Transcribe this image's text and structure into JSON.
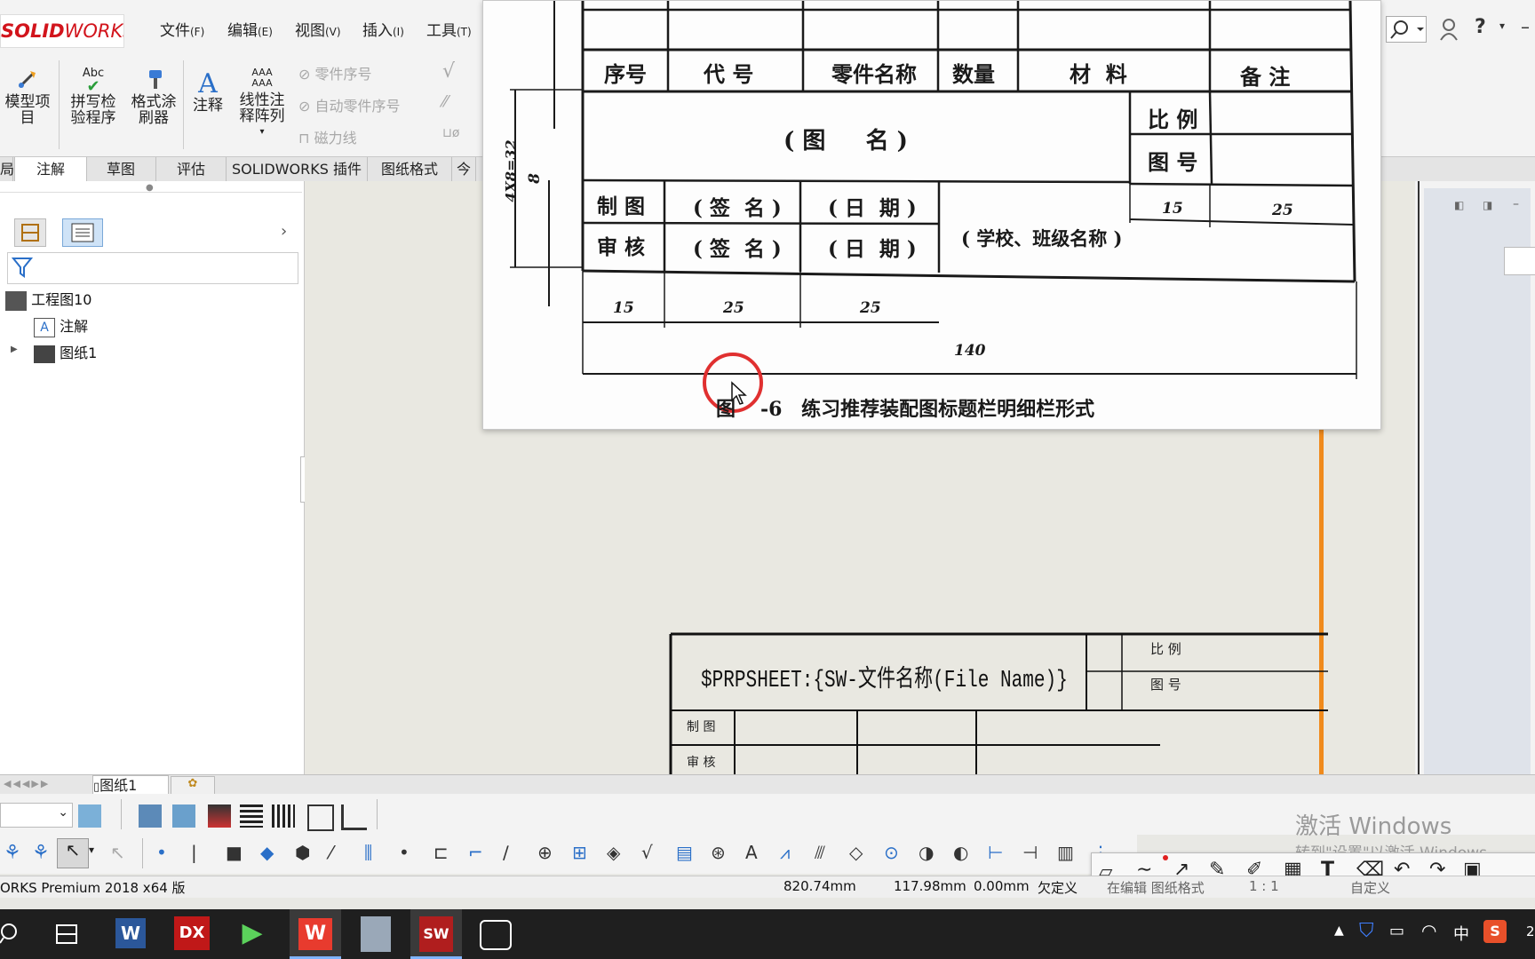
{
  "app": {
    "logo_solid": "SOLID",
    "logo_works": "WORKS"
  },
  "menu": [
    {
      "label": "文件",
      "key": "(F)"
    },
    {
      "label": "编辑",
      "key": "(E)"
    },
    {
      "label": "视图",
      "key": "(V)"
    },
    {
      "label": "插入",
      "key": "(I)"
    },
    {
      "label": "工具",
      "key": "(T)"
    }
  ],
  "ribbon": {
    "model_items": "模型项目",
    "model_items_l1": "模型项",
    "model_items_l2": "目",
    "spell_check_l1": "拼写检",
    "spell_check_l2": "验程序",
    "spell_icon_text": "Abc",
    "format_painter_l1": "格式涂",
    "format_painter_l2": "刷器",
    "note": "注释",
    "linear_pattern_l1": "线性注",
    "linear_pattern_l2": "释阵列",
    "pattern_icon_text": "AAA",
    "balloon": "零件序号",
    "auto_balloon": "自动零件序号",
    "magnetic_line": "磁力线"
  },
  "tabs": [
    {
      "label": "局"
    },
    {
      "label": "注解"
    },
    {
      "label": "草图"
    },
    {
      "label": "评估"
    },
    {
      "label": "SOLIDWORKS 插件"
    },
    {
      "label": "图纸格式"
    },
    {
      "label": "今"
    }
  ],
  "tree": {
    "root": "工程图10",
    "annotations": "注解",
    "sheet": "图纸1"
  },
  "overlay": {
    "row_label": "序号",
    "code": "代 号",
    "part_name": "零件名称",
    "quantity": "数量",
    "material": "材  料",
    "remarks": "备 注",
    "drawing_name": "( 图     名 )",
    "scale": "比 例",
    "drawing_no": "图 号",
    "drafter": "制 图",
    "checker": "审 核",
    "signature": "( 签  名 )",
    "date": "( 日  期 )",
    "school": "( 学校、班级名称 )",
    "dim_4x8": "4X8=32",
    "dim_8": "8",
    "dim_15": "15",
    "dim_25": "25",
    "dim_140": "140",
    "caption_prefix": "图",
    "caption_num": "-6",
    "caption_text": "练习推荐装配图标题栏明细栏形式"
  },
  "titleblock": {
    "name_field": "$PRPSHEET:{SW-文件名称(File Name)}",
    "scale": "比 例",
    "drawing_no": "图 号",
    "drafter": "制 图",
    "checker": "审 核"
  },
  "sheet_tab": "图纸1",
  "watermark": {
    "line1": "激活 Windows",
    "line2": "转到\"设置\"以激活 Windows。"
  },
  "status": {
    "product": "ORKS Premium 2018 x64 版",
    "x": "820.74mm",
    "y": "117.98mm",
    "z": "0.00mm",
    "state": "欠定义",
    "edit": "在编辑 图纸格式",
    "scale": "1 : 1",
    "custom": "自定义"
  },
  "taskbar": {
    "ime": "中",
    "time": "2"
  },
  "colors": {
    "accent_orange": "#f08a1c",
    "logo_red": "#d2141c",
    "taskbar": "#1f1f1f"
  }
}
